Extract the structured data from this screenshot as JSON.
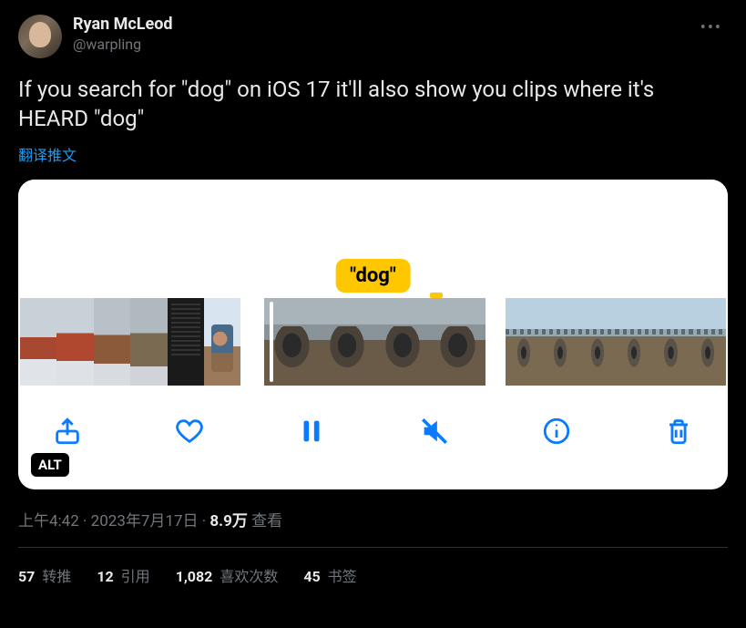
{
  "author": {
    "display_name": "Ryan McLeod",
    "handle": "@warpling"
  },
  "tweet_text": "If you search for \"dog\" on iOS 17 it'll also show you clips where it's HEARD \"dog\"",
  "translate_label": "翻译推文",
  "media": {
    "caption_pill": "\"dog\"",
    "alt_badge": "ALT",
    "toolbar_icons": [
      "share",
      "heart",
      "pause",
      "mute",
      "info",
      "trash"
    ]
  },
  "meta": {
    "time": "上午4:42",
    "dot1": " · ",
    "date": "2023年7月17日",
    "dot2": " · ",
    "views_count": "8.9万",
    "views_label": " 查看"
  },
  "stats": {
    "retweets_count": "57",
    "retweets_label": " 转推",
    "quotes_count": "12",
    "quotes_label": " 引用",
    "likes_count": "1,082",
    "likes_label": " 喜欢次数",
    "bookmarks_count": "45",
    "bookmarks_label": " 书签"
  }
}
